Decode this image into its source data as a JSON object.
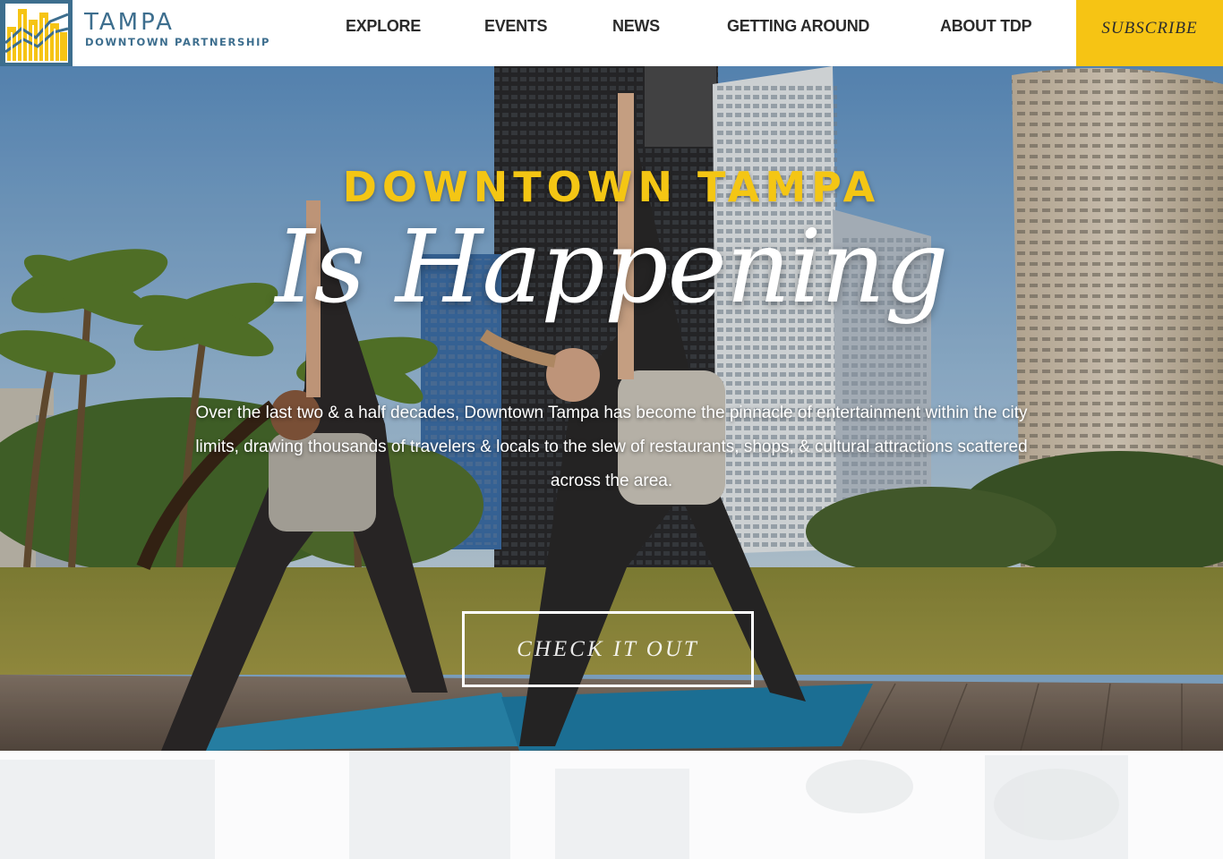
{
  "header": {
    "brand_name": "TAMPA",
    "brand_subtitle": "DOWNTOWN PARTNERSHIP",
    "nav": [
      {
        "label": "EXPLORE"
      },
      {
        "label": "EVENTS"
      },
      {
        "label": "NEWS"
      },
      {
        "label": "GETTING AROUND"
      },
      {
        "label": "ABOUT TDP"
      }
    ],
    "subscribe_label": "SUBSCRIBE"
  },
  "hero": {
    "eyebrow": "DOWNTOWN TAMPA",
    "headline": "Is Happening",
    "intro": "Over the last two & a half decades, Downtown Tampa has become the pinnacle of entertainment within the city limits, drawing thousands of travelers & locals to the slew of restaurants, shops, & cultural attractions scattered across the area.",
    "cta_label": "CHECK IT OUT"
  },
  "colors": {
    "brand_blue": "#3d6e8e",
    "accent_yellow": "#f6c414",
    "headline_yellow": "#f4c614",
    "text_dark": "#2b2b2b"
  },
  "icons": {
    "logo": "tampa-skyline-logo-icon"
  }
}
